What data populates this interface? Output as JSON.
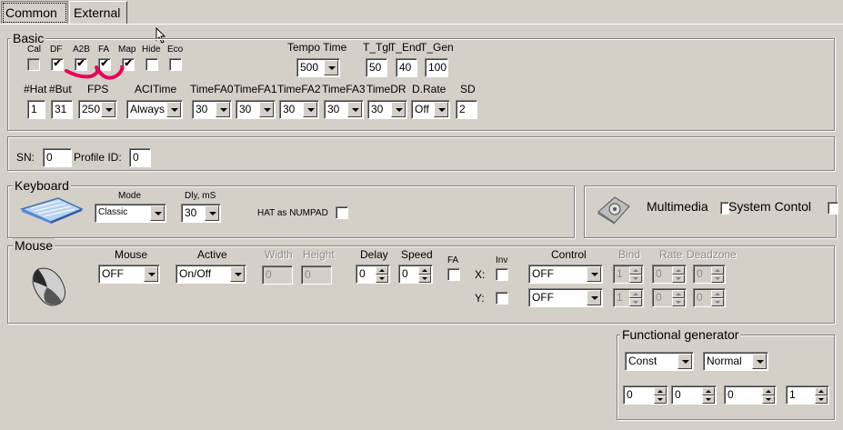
{
  "tabs": [
    "Common",
    "External"
  ],
  "basic": {
    "legend": "Basic",
    "checkboxes": [
      {
        "label": "Cal",
        "checked": false,
        "disabled": true
      },
      {
        "label": "DF",
        "checked": true
      },
      {
        "label": "A2B",
        "checked": true
      },
      {
        "label": "FA",
        "checked": true
      },
      {
        "label": "Map",
        "checked": true
      },
      {
        "label": "Hide",
        "checked": false
      },
      {
        "label": "Eco",
        "checked": false
      }
    ],
    "tempo_time_label": "Tempo Time",
    "tempo_time_value": "500",
    "t_tgl_label": "T_Tgl",
    "t_tgl_value": "50",
    "t_end_label": "T_End",
    "t_end_value": "40",
    "t_gen_label": "T_Gen",
    "t_gen_value": "100",
    "hat_label": "#Hat",
    "hat_value": "1",
    "but_label": "#But",
    "but_value": "31",
    "fps_label": "FPS",
    "fps_value": "250",
    "acitime_label": "ACITime",
    "acitime_value": "Always",
    "timefa0_label": "TimeFA0",
    "timefa0_value": "30",
    "timefa1_label": "TimeFA1",
    "timefa1_value": "30",
    "timefa2_label": "TimeFA2",
    "timefa2_value": "30",
    "timefa3_label": "TimeFA3",
    "timefa3_value": "30",
    "timedr_label": "TimeDR",
    "timedr_value": "30",
    "drate_label": "D.Rate",
    "drate_value": "Off",
    "sd_label": "SD",
    "sd_value": "2"
  },
  "sn": {
    "sn_label": "SN:",
    "sn_value": "0",
    "profile_label": "Profile ID:",
    "profile_value": "0"
  },
  "keyboard": {
    "legend": "Keyboard",
    "mode_label": "Mode",
    "mode_value": "Classic",
    "dly_label": "Dly, mS",
    "dly_value": "30",
    "hat_numpad_label": "HAT as NUMPAD"
  },
  "multimedia": {
    "multimedia_label": "Multimedia",
    "system_control_label": "System Contol"
  },
  "mouse": {
    "legend": "Mouse",
    "headers": {
      "mouse": "Mouse",
      "active": "Active",
      "width": "Width",
      "height": "Height",
      "delay": "Delay",
      "speed": "Speed",
      "fa": "FA",
      "inv": "Inv",
      "control": "Control",
      "bind": "Bind",
      "rate": "Rate",
      "deadzone": "Deadzone"
    },
    "mouse_value": "OFF",
    "active_value": "On/Off",
    "width_value": "0",
    "height_value": "0",
    "delay_value": "0",
    "speed_value": "0",
    "x_label": "X:",
    "y_label": "Y:",
    "x_control": "OFF",
    "y_control": "OFF",
    "x_bind": "1",
    "x_rate": "0",
    "x_deadzone": "0",
    "y_bind": "1",
    "y_rate": "0",
    "y_deadzone": "0"
  },
  "generator": {
    "legend": "Functional generator",
    "wave_value": "Const",
    "mode_value": "Normal",
    "spin_values": [
      "0",
      "0",
      "0",
      "1"
    ]
  },
  "colors": {
    "annotation": "#e8005a",
    "background": "#d4d0c8"
  }
}
